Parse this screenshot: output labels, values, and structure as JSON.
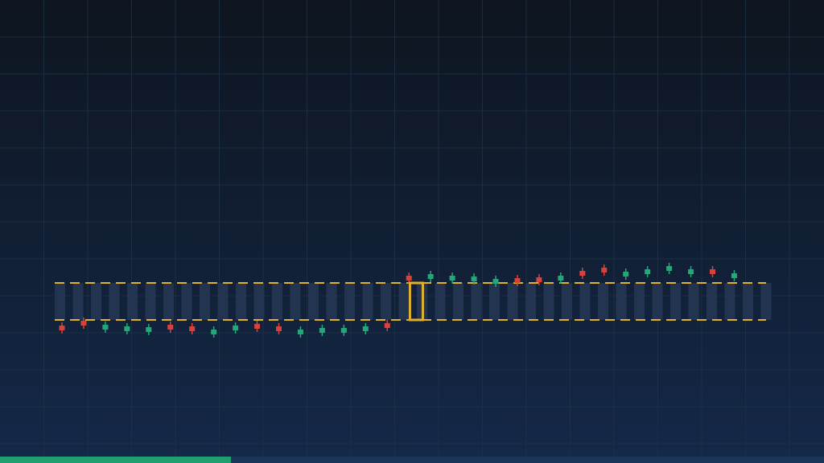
{
  "colors": {
    "bg_top": "#0e151f",
    "bg_bottom": "#142848",
    "grid": "#1d3347",
    "track_column": "#22344f",
    "dash": "#e0b12e",
    "cursor": "#e0b12e",
    "candle_up": "#23a877",
    "candle_down": "#d9413a",
    "progress_track": "#1b3559",
    "progress_fill": "#1f9f6e"
  },
  "progress": {
    "fraction": 0.28
  },
  "track": {
    "column_count": 40,
    "cursor_index": 19
  },
  "candles": [
    {
      "side": "bottom",
      "color": "down",
      "offset": 10
    },
    {
      "side": "bottom",
      "color": "down",
      "offset": 4
    },
    {
      "side": "bottom",
      "color": "up",
      "offset": 9
    },
    {
      "side": "bottom",
      "color": "up",
      "offset": 11
    },
    {
      "side": "bottom",
      "color": "up",
      "offset": 12
    },
    {
      "side": "bottom",
      "color": "down",
      "offset": 9
    },
    {
      "side": "bottom",
      "color": "down",
      "offset": 11
    },
    {
      "side": "bottom",
      "color": "up",
      "offset": 15
    },
    {
      "side": "bottom",
      "color": "up",
      "offset": 10
    },
    {
      "side": "bottom",
      "color": "down",
      "offset": 8
    },
    {
      "side": "bottom",
      "color": "down",
      "offset": 11
    },
    {
      "side": "bottom",
      "color": "up",
      "offset": 15
    },
    {
      "side": "bottom",
      "color": "up",
      "offset": 13
    },
    {
      "side": "bottom",
      "color": "up",
      "offset": 13
    },
    {
      "side": "bottom",
      "color": "up",
      "offset": 11
    },
    {
      "side": "bottom",
      "color": "down",
      "offset": 7
    },
    {
      "side": "top",
      "color": "down",
      "offset": 6
    },
    {
      "side": "top",
      "color": "up",
      "offset": 8
    },
    {
      "side": "top",
      "color": "up",
      "offset": 6
    },
    {
      "side": "top",
      "color": "up",
      "offset": 5
    },
    {
      "side": "top",
      "color": "up",
      "offset": 2
    },
    {
      "side": "top",
      "color": "down",
      "offset": 3
    },
    {
      "side": "top",
      "color": "down",
      "offset": 4
    },
    {
      "side": "top",
      "color": "up",
      "offset": 6
    },
    {
      "side": "top",
      "color": "down",
      "offset": 12
    },
    {
      "side": "top",
      "color": "down",
      "offset": 16
    },
    {
      "side": "top",
      "color": "up",
      "offset": 11
    },
    {
      "side": "top",
      "color": "up",
      "offset": 14
    },
    {
      "side": "top",
      "color": "up",
      "offset": 18
    },
    {
      "side": "top",
      "color": "up",
      "offset": 14
    },
    {
      "side": "top",
      "color": "down",
      "offset": 14
    },
    {
      "side": "top",
      "color": "up",
      "offset": 9
    }
  ]
}
